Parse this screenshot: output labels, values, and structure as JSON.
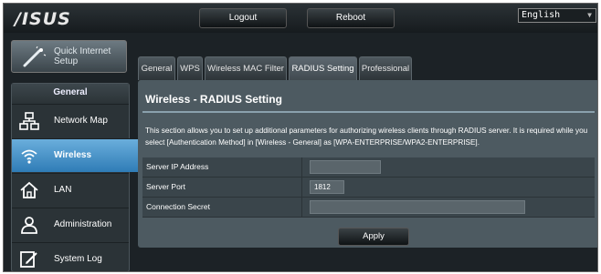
{
  "header": {
    "logo": "/ISUS",
    "logout_label": "Logout",
    "reboot_label": "Reboot",
    "language": "English"
  },
  "sidebar": {
    "quick_setup_line1": "Quick Internet",
    "quick_setup_line2": "Setup",
    "section_title": "General",
    "items": [
      {
        "label": "Network Map",
        "icon": "network-map-icon"
      },
      {
        "label": "Wireless",
        "icon": "wireless-icon",
        "active": true
      },
      {
        "label": "LAN",
        "icon": "lan-icon"
      },
      {
        "label": "Administration",
        "icon": "administration-icon"
      },
      {
        "label": "System Log",
        "icon": "system-log-icon"
      }
    ]
  },
  "tabs": [
    {
      "label": "General"
    },
    {
      "label": "WPS"
    },
    {
      "label": "Wireless MAC Filter"
    },
    {
      "label": "RADIUS Setting",
      "active": true
    },
    {
      "label": "Professional"
    }
  ],
  "main": {
    "title": "Wireless - RADIUS Setting",
    "description": "This section allows you to set up additional parameters for authorizing wireless clients through RADIUS server. It is required while you select [Authentication Method] in [Wireless - General] as [WPA-ENTERPRISE/WPA2-ENTERPRISE].",
    "fields": [
      {
        "label": "Server IP Address",
        "value": ""
      },
      {
        "label": "Server Port",
        "value": "1812"
      },
      {
        "label": "Connection Secret",
        "value": ""
      }
    ],
    "apply_label": "Apply"
  },
  "colors": {
    "active_blue": "#3a86bf",
    "panel_bg": "#4d5a61",
    "page_bg": "#1c2226"
  }
}
